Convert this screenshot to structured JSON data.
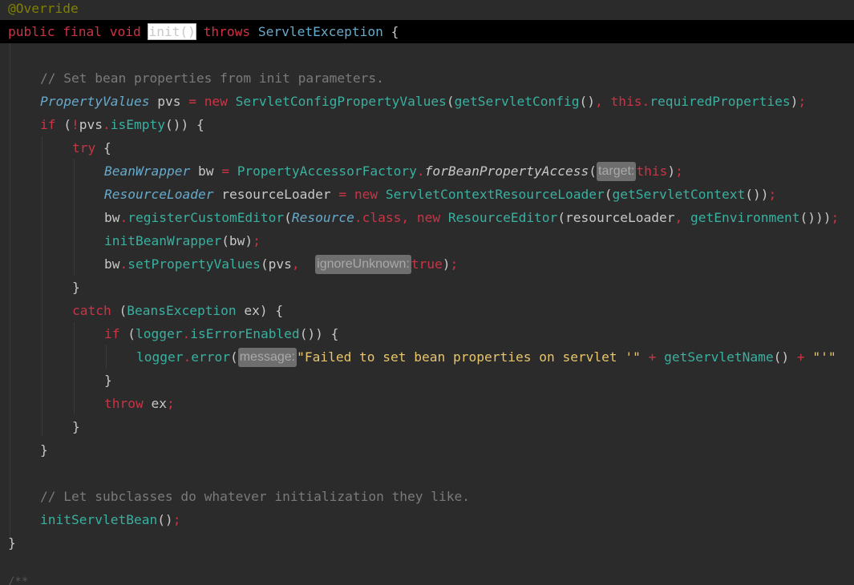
{
  "colors": {
    "background": "#2b2b2b",
    "current_line": "#000000",
    "annotation": "#808000",
    "keyword": "#cc3344",
    "type": "#66aacc",
    "method": "#39b0a0",
    "plain": "#c8c8c8",
    "comment": "#7a7a7a",
    "string": "#e8c56a",
    "operator": "#cc3344",
    "hint_bg": "#6e6e6e"
  },
  "lines": [
    {
      "indent": 0,
      "tokens": [
        {
          "t": "@Override",
          "c": "annotation"
        }
      ]
    },
    {
      "indent": 0,
      "current": true,
      "tokens": [
        {
          "t": "public ",
          "c": "keyword"
        },
        {
          "t": "final ",
          "c": "keyword"
        },
        {
          "t": "void ",
          "c": "keyword"
        },
        {
          "t": "init()",
          "c": "plain",
          "boxed": true
        },
        {
          "t": " ",
          "c": "plain"
        },
        {
          "t": "throws ",
          "c": "keyword"
        },
        {
          "t": "ServletException",
          "c": "type"
        },
        {
          "t": " {",
          "c": "plain"
        }
      ]
    },
    {
      "indent": 0,
      "tokens": []
    },
    {
      "indent": 1,
      "tokens": [
        {
          "t": "// Set bean properties from init parameters.",
          "c": "comment"
        }
      ]
    },
    {
      "indent": 1,
      "tokens": [
        {
          "t": "PropertyValues",
          "c": "type",
          "italic": true
        },
        {
          "t": " pvs ",
          "c": "plain"
        },
        {
          "t": "= ",
          "c": "operator"
        },
        {
          "t": "new ",
          "c": "keyword"
        },
        {
          "t": "ServletConfigPropertyValues",
          "c": "method"
        },
        {
          "t": "(",
          "c": "plain"
        },
        {
          "t": "getServletConfig",
          "c": "method"
        },
        {
          "t": "()",
          "c": "plain"
        },
        {
          "t": ", ",
          "c": "operator"
        },
        {
          "t": "this",
          "c": "keyword"
        },
        {
          "t": ".",
          "c": "operator"
        },
        {
          "t": "requiredProperties",
          "c": "method"
        },
        {
          "t": ")",
          "c": "plain"
        },
        {
          "t": ";",
          "c": "operator"
        }
      ]
    },
    {
      "indent": 1,
      "tokens": [
        {
          "t": "if ",
          "c": "keyword"
        },
        {
          "t": "(",
          "c": "plain"
        },
        {
          "t": "!",
          "c": "operator"
        },
        {
          "t": "pvs",
          "c": "plain"
        },
        {
          "t": ".",
          "c": "operator"
        },
        {
          "t": "isEmpty",
          "c": "method"
        },
        {
          "t": "()) {",
          "c": "plain"
        }
      ]
    },
    {
      "indent": 2,
      "tokens": [
        {
          "t": "try ",
          "c": "keyword"
        },
        {
          "t": "{",
          "c": "plain"
        }
      ]
    },
    {
      "indent": 3,
      "tokens": [
        {
          "t": "BeanWrapper",
          "c": "type",
          "italic": true
        },
        {
          "t": " bw ",
          "c": "plain"
        },
        {
          "t": "= ",
          "c": "operator"
        },
        {
          "t": "PropertyAccessorFactory",
          "c": "method"
        },
        {
          "t": ".",
          "c": "operator"
        },
        {
          "t": "forBeanPropertyAccess",
          "c": "plain",
          "italic": true
        },
        {
          "t": "(",
          "c": "plain"
        },
        {
          "t": "target:",
          "c": "hint"
        },
        {
          "t": "this",
          "c": "keyword"
        },
        {
          "t": ")",
          "c": "plain"
        },
        {
          "t": ";",
          "c": "operator"
        }
      ]
    },
    {
      "indent": 3,
      "tokens": [
        {
          "t": "ResourceLoader",
          "c": "type",
          "italic": true
        },
        {
          "t": " resourceLoader ",
          "c": "plain"
        },
        {
          "t": "= ",
          "c": "operator"
        },
        {
          "t": "new ",
          "c": "keyword"
        },
        {
          "t": "ServletContextResourceLoader",
          "c": "method"
        },
        {
          "t": "(",
          "c": "plain"
        },
        {
          "t": "getServletContext",
          "c": "method"
        },
        {
          "t": "())",
          "c": "plain"
        },
        {
          "t": ";",
          "c": "operator"
        }
      ]
    },
    {
      "indent": 3,
      "tokens": [
        {
          "t": "bw",
          "c": "plain"
        },
        {
          "t": ".",
          "c": "operator"
        },
        {
          "t": "registerCustomEditor",
          "c": "method"
        },
        {
          "t": "(",
          "c": "plain"
        },
        {
          "t": "Resource",
          "c": "type",
          "italic": true
        },
        {
          "t": ".",
          "c": "operator"
        },
        {
          "t": "class",
          "c": "keyword"
        },
        {
          "t": ", ",
          "c": "operator"
        },
        {
          "t": "new ",
          "c": "keyword"
        },
        {
          "t": "ResourceEditor",
          "c": "method"
        },
        {
          "t": "(resourceLoader",
          "c": "plain"
        },
        {
          "t": ", ",
          "c": "operator"
        },
        {
          "t": "getEnvironment",
          "c": "method"
        },
        {
          "t": "()))",
          "c": "plain"
        },
        {
          "t": ";",
          "c": "operator"
        }
      ]
    },
    {
      "indent": 3,
      "tokens": [
        {
          "t": "initBeanWrapper",
          "c": "method"
        },
        {
          "t": "(bw)",
          "c": "plain"
        },
        {
          "t": ";",
          "c": "operator"
        }
      ]
    },
    {
      "indent": 3,
      "tokens": [
        {
          "t": "bw",
          "c": "plain"
        },
        {
          "t": ".",
          "c": "operator"
        },
        {
          "t": "setPropertyValues",
          "c": "method"
        },
        {
          "t": "(pvs",
          "c": "plain"
        },
        {
          "t": ",  ",
          "c": "operator"
        },
        {
          "t": "ignoreUnknown:",
          "c": "hint"
        },
        {
          "t": "true",
          "c": "keyword"
        },
        {
          "t": ")",
          "c": "plain"
        },
        {
          "t": ";",
          "c": "operator"
        }
      ]
    },
    {
      "indent": 2,
      "tokens": [
        {
          "t": "}",
          "c": "plain"
        }
      ]
    },
    {
      "indent": 2,
      "tokens": [
        {
          "t": "catch ",
          "c": "keyword"
        },
        {
          "t": "(",
          "c": "plain"
        },
        {
          "t": "BeansException",
          "c": "method"
        },
        {
          "t": " ex) {",
          "c": "plain"
        }
      ]
    },
    {
      "indent": 3,
      "tokens": [
        {
          "t": "if ",
          "c": "keyword"
        },
        {
          "t": "(",
          "c": "plain"
        },
        {
          "t": "logger",
          "c": "method"
        },
        {
          "t": ".",
          "c": "operator"
        },
        {
          "t": "isErrorEnabled",
          "c": "method"
        },
        {
          "t": "()) {",
          "c": "plain"
        }
      ]
    },
    {
      "indent": 4,
      "tokens": [
        {
          "t": "logger",
          "c": "method"
        },
        {
          "t": ".",
          "c": "operator"
        },
        {
          "t": "error",
          "c": "method"
        },
        {
          "t": "(",
          "c": "plain"
        },
        {
          "t": "message:",
          "c": "hint"
        },
        {
          "t": "\"Failed to set bean properties on servlet '\"",
          "c": "string"
        },
        {
          "t": " + ",
          "c": "operator"
        },
        {
          "t": "getServletName",
          "c": "method"
        },
        {
          "t": "() ",
          "c": "plain"
        },
        {
          "t": "+ ",
          "c": "operator"
        },
        {
          "t": "\"'\"",
          "c": "string"
        }
      ]
    },
    {
      "indent": 3,
      "tokens": [
        {
          "t": "}",
          "c": "plain"
        }
      ]
    },
    {
      "indent": 3,
      "tokens": [
        {
          "t": "throw ",
          "c": "keyword"
        },
        {
          "t": "ex",
          "c": "plain"
        },
        {
          "t": ";",
          "c": "operator"
        }
      ]
    },
    {
      "indent": 2,
      "tokens": [
        {
          "t": "}",
          "c": "plain"
        }
      ]
    },
    {
      "indent": 1,
      "tokens": [
        {
          "t": "}",
          "c": "plain"
        }
      ]
    },
    {
      "indent": 0,
      "tokens": []
    },
    {
      "indent": 1,
      "tokens": [
        {
          "t": "// Let subclasses do whatever initialization they like.",
          "c": "comment"
        }
      ]
    },
    {
      "indent": 1,
      "tokens": [
        {
          "t": "initServletBean",
          "c": "method"
        },
        {
          "t": "()",
          "c": "plain"
        },
        {
          "t": ";",
          "c": "operator"
        }
      ]
    },
    {
      "indent": 0,
      "tokens": [
        {
          "t": "}",
          "c": "plain"
        }
      ]
    }
  ],
  "trailing_fragment": "/**"
}
